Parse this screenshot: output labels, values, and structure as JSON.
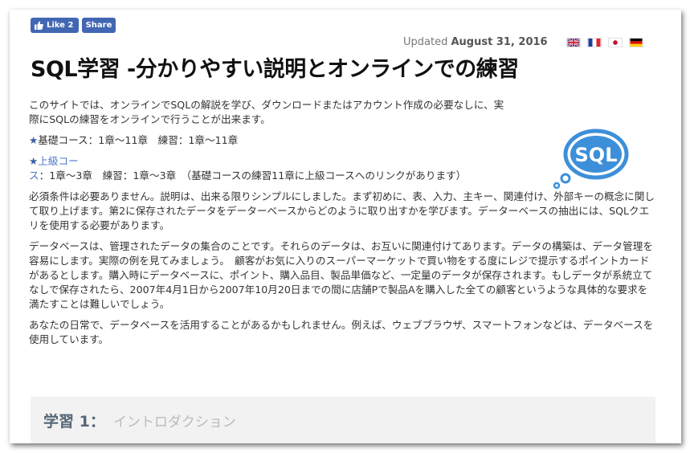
{
  "social": {
    "like_label": "Like 2",
    "share_label": "Share"
  },
  "updated": {
    "prefix": "Updated",
    "date": "August 31, 2016"
  },
  "flags": [
    "uk-flag",
    "france-flag",
    "japan-flag",
    "germany-flag"
  ],
  "title": "SQL学習 -分かりやすい説明とオンラインでの練習",
  "intro": "このサイトでは、オンラインでSQLの解説を学び、ダウンロードまたはアカウント作成の必要なしに、実際にSQLの練習をオンラインで行うことが出来ます。",
  "basic_course": {
    "star": "★",
    "text": "基礎コース：1章～11章　練習：1章～11章"
  },
  "advanced_course": {
    "star": "★",
    "link": "上級コース",
    "text": "：1章～3章　練習：1章～3章　（基礎コースの練習11章に上級コースへのリンクがあります）"
  },
  "paragraphs": [
    "必須条件は必要ありません。説明は、出来る限りシンプルにしました。まず初めに、表、入力、主キー、関連付け、外部キーの概念に関して取り上げます。第2に保存されたデータをデーターベースからどのように取り出すかを学びます。データーベースの抽出には、SQLクエリを使用する必要があります。",
    "データベースは、管理されたデータの集合のことです。それらのデータは、お互いに関連付けてあります。データの構築は、データ管理を容易にします。実際の例を見てみましょう。　顧客がお気に入りのスーパーマーケットで買い物をする度にレジで提示するポイントカードがあるとします。購入時にデータベースに、ポイント、購入品目、製品単価など、一定量のデータが保存されます。もしデータが系統立てなしで保存されたら、2007年4月1日から2007年10月20日までの間に店舗Pで製品Aを購入した全ての顧客というような具体的な要求を満たすことは難しいでしょう。",
    "あなたの日常で、データベースを活用することがあるかもしれません。例えば、ウェブブラウザ、スマートフォンなどは、データベースを使用しています。"
  ],
  "sql_badge": "SQL",
  "lesson": {
    "label": "学習 1：",
    "subtitle": "イントロダクション"
  },
  "colors": {
    "facebook": "#4267b2",
    "link": "#4a77c9",
    "bubble": "#3d8fd9",
    "lesson_bg": "#f2f2f2"
  }
}
